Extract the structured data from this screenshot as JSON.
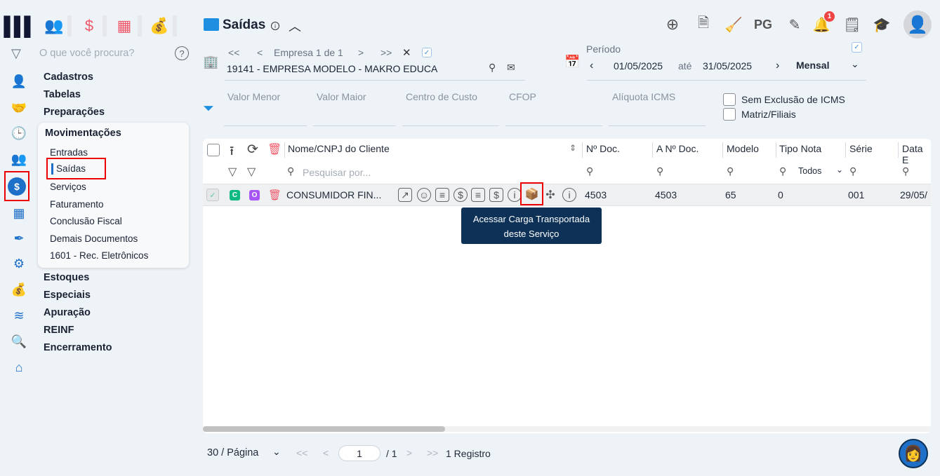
{
  "top_modules": [
    {
      "icon": "users-icon"
    },
    {
      "icon": "dollar-icon"
    },
    {
      "icon": "calculator-icon"
    },
    {
      "icon": "money-bag-icon"
    }
  ],
  "search": {
    "placeholder": "O que você procura?"
  },
  "menu": [
    "Cadastros",
    "Tabelas",
    "Preparações",
    "Movimentações",
    "Estoques",
    "Especiais",
    "Apuração",
    "REINF",
    "Encerramento"
  ],
  "submenu": [
    "Entradas",
    "Saídas",
    "Serviços",
    "Faturamento",
    "Conclusão Fiscal",
    "Demais Documentos",
    "1601 - Rec. Eletrônicos"
  ],
  "header": {
    "title": "Saídas",
    "actions": [
      "plus-circle-icon",
      "document-icon",
      "broom-icon",
      "PG",
      "edit-icon",
      "bell-icon",
      "report-search-icon",
      "graduation-cap-icon"
    ],
    "notifications": "1"
  },
  "empresa": {
    "nav": "Empresa 1 de 1",
    "value": "19141 - EMPRESA MODELO - MAKRO EDUCA"
  },
  "periodo": {
    "label": "Período",
    "from": "01/05/2025",
    "sep": "até",
    "to": "31/05/2025",
    "mode": "Mensal"
  },
  "filters": {
    "fields": [
      "Valor Menor",
      "Valor Maior",
      "Centro de Custo",
      "CFOP",
      "Alíquota ICMS"
    ],
    "checks": [
      "Sem Exclusão de ICMS",
      "Matriz/Filiais"
    ]
  },
  "table": {
    "columns": [
      "Nome/CNPJ do Cliente",
      "Nº Doc.",
      "A Nº Doc.",
      "Modelo",
      "Tipo Nota",
      "Série",
      "Data E"
    ],
    "search_placeholder": "Pesquisar por...",
    "tipo_filter": "Todos",
    "rows": [
      {
        "badge1": "C",
        "badge2": "O",
        "nome": "CONSUMIDOR FIN...",
        "ndoc": "4503",
        "andoc": "4503",
        "modelo": "65",
        "tipo": "0",
        "serie": "001",
        "data": "29/05/"
      }
    ]
  },
  "tooltip": {
    "line1": "Acessar Carga Transportada",
    "line2": "deste Serviço"
  },
  "pagination": {
    "per_page": "30 / Página",
    "page": "1",
    "total_pages": "/ 1",
    "records": "1 Registro"
  }
}
